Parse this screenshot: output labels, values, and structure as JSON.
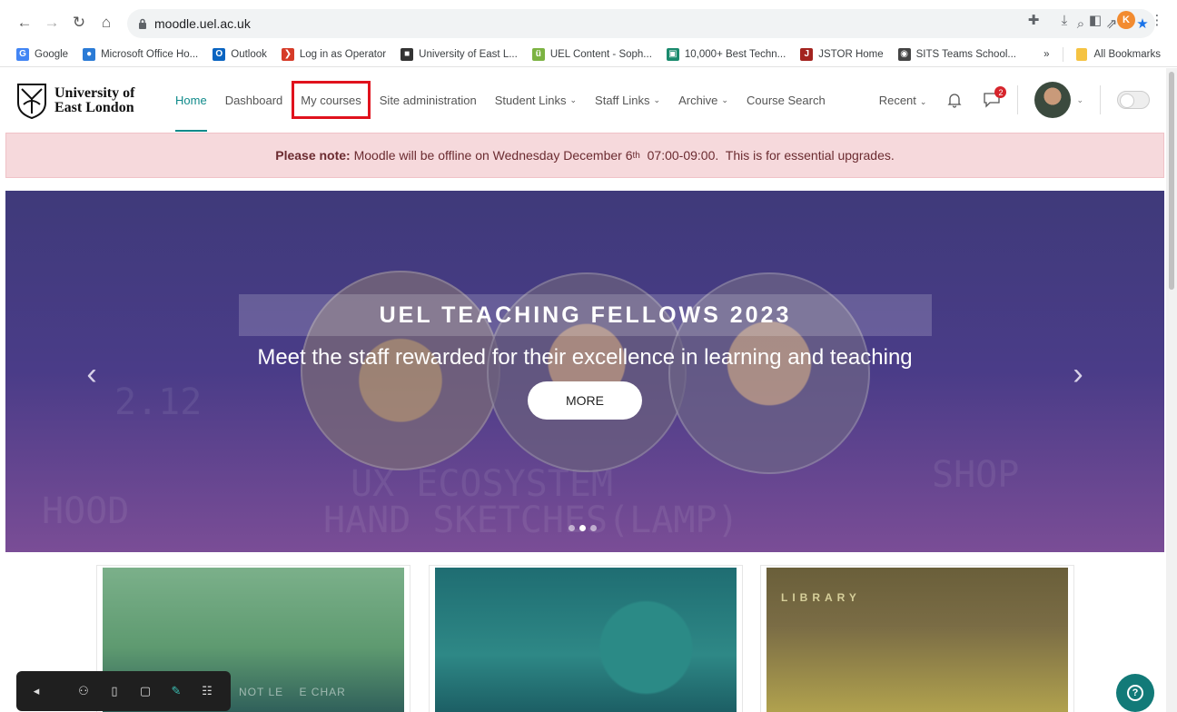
{
  "browser": {
    "url": "moodle.uel.ac.uk",
    "profile_initial": "K",
    "bookmarks": [
      {
        "label": "Google",
        "color": "#4285f4",
        "glyph": "G"
      },
      {
        "label": "Microsoft Office Ho...",
        "color": "#2b7bd6",
        "glyph": "●"
      },
      {
        "label": "Outlook",
        "color": "#0a64c1",
        "glyph": "O"
      },
      {
        "label": "Log in as Operator",
        "color": "#d63b28",
        "glyph": "❯"
      },
      {
        "label": "University of East L...",
        "color": "#333333",
        "glyph": "■"
      },
      {
        "label": "UEL Content - Soph...",
        "color": "#7cb342",
        "glyph": "ü"
      },
      {
        "label": "10,000+ Best Techn...",
        "color": "#1a8a6d",
        "glyph": "▣"
      },
      {
        "label": "JSTOR Home",
        "color": "#a3231f",
        "glyph": "J"
      },
      {
        "label": "SITS Teams School...",
        "color": "#444444",
        "glyph": "◉"
      }
    ],
    "bookmarks_overflow": "»",
    "all_bookmarks": "All Bookmarks"
  },
  "site": {
    "logo_line1": "University of",
    "logo_line2": "East London",
    "nav": [
      {
        "label": "Home",
        "active": true
      },
      {
        "label": "Dashboard"
      },
      {
        "label": "My courses",
        "highlight": true
      },
      {
        "label": "Site administration"
      },
      {
        "label": "Student Links",
        "dropdown": true
      },
      {
        "label": "Staff Links",
        "dropdown": true
      },
      {
        "label": "Archive",
        "dropdown": true
      },
      {
        "label": "Course Search"
      }
    ],
    "recent_label": "Recent",
    "message_count": "2"
  },
  "notice": {
    "bold": "Please note:",
    "text_before": " Moodle will be offline on Wednesday December 6",
    "sup": "th",
    "text_after": "  07:00-09:00.  This is for essential upgrades."
  },
  "hero": {
    "title": "UEL TEACHING FELLOWS 2023",
    "subtitle": "Meet the staff rewarded for their excellence in learning and teaching",
    "button": "MORE",
    "slide_index": 2,
    "slide_count": 3
  },
  "cards": [
    {
      "overlay": "NOT LE    E CHAR"
    },
    {
      "overlay": ""
    },
    {
      "overlay": "LIBRARY"
    }
  ],
  "colors": {
    "accent": "#0f8a8a",
    "highlight_box": "#e0121d",
    "notice_bg": "#f6d9dc",
    "hero_bg": "#45398a"
  }
}
